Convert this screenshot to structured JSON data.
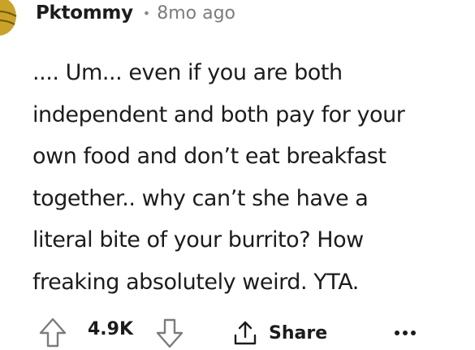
{
  "comment": {
    "author": "Pktommy",
    "separator": "•",
    "timestamp": "8mo ago",
    "body_lines": [
      ".... Um... even if you are both",
      "independent and both pay for your",
      "own food and don’t eat breakfast",
      "together.. why can’t she have a",
      "literal bite of your burrito? How",
      "freaking absolutely weird. YTA."
    ],
    "avatar_icon": "snoo-avatar-icon",
    "avatar_color": "#c9a227"
  },
  "actions": {
    "upvote_icon": "arrow-up-icon",
    "score": "4.9K",
    "downvote_icon": "arrow-down-icon",
    "share_icon": "share-icon",
    "share_label": "Share",
    "more_icon": "more-horizontal-icon"
  }
}
